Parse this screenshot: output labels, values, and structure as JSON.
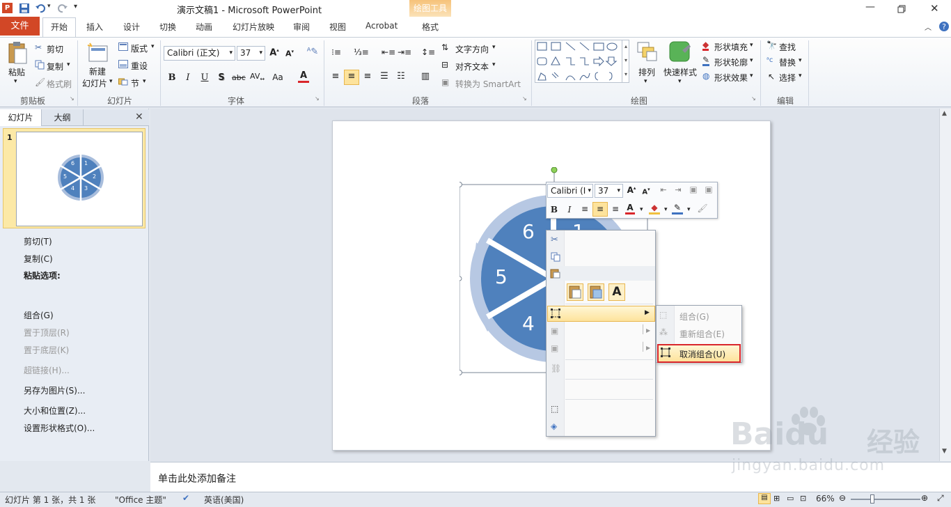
{
  "window": {
    "title": "演示文稿1 - Microsoft PowerPoint"
  },
  "context_tab_group": {
    "label": "绘图工具",
    "tab": "格式"
  },
  "tabs": [
    {
      "label": "文件"
    },
    {
      "label": "开始"
    },
    {
      "label": "插入"
    },
    {
      "label": "设计"
    },
    {
      "label": "切换"
    },
    {
      "label": "动画"
    },
    {
      "label": "幻灯片放映"
    },
    {
      "label": "审阅"
    },
    {
      "label": "视图"
    },
    {
      "label": "Acrobat"
    }
  ],
  "ribbon": {
    "clipboard": {
      "label": "剪贴板",
      "paste": "粘贴",
      "cut": "剪切",
      "copy": "复制",
      "format_painter": "格式刷"
    },
    "slides": {
      "label": "幻灯片",
      "new_slide_1": "新建",
      "new_slide_2": "幻灯片",
      "layout": "版式",
      "reset": "重设",
      "section": "节"
    },
    "font": {
      "label": "字体",
      "font_name": "Calibri (正文)",
      "font_size": "37"
    },
    "paragraph": {
      "label": "段落",
      "text_direction": "文字方向",
      "align_text": "对齐文本",
      "smartart": "转换为 SmartArt"
    },
    "drawing": {
      "label": "绘图",
      "arrange": "排列",
      "quick_styles": "快速样式",
      "shape_fill": "形状填充",
      "shape_outline": "形状轮廓",
      "shape_effects": "形状效果"
    },
    "editing": {
      "label": "编辑",
      "find": "查找",
      "replace": "替换",
      "select": "选择"
    }
  },
  "left_pane": {
    "tab_slides": "幻灯片",
    "tab_outline": "大纲",
    "slide_number": "1",
    "thumb_numbers": [
      "1",
      "2",
      "3",
      "4",
      "5",
      "6"
    ]
  },
  "slide": {
    "segments": [
      "6",
      "1",
      "5",
      "4"
    ]
  },
  "mini_toolbar": {
    "font_name": "Calibri (I",
    "font_size": "37"
  },
  "context_menu": {
    "cut": "剪切(T)",
    "copy": "复制(C)",
    "paste_options": "粘贴选项:",
    "group": "组合(G)",
    "bring_to_front": "置于顶层(R)",
    "send_to_back": "置于底层(K)",
    "hyperlink": "超链接(H)...",
    "save_as_picture": "另存为图片(S)...",
    "size_position": "大小和位置(Z)...",
    "format_shape": "设置形状格式(O)..."
  },
  "submenu": {
    "group": "组合(G)",
    "regroup": "重新组合(E)",
    "ungroup": "取消组合(U)"
  },
  "notes": {
    "placeholder": "单击此处添加备注"
  },
  "status": {
    "slide_info": "幻灯片 第 1 张，共 1 张",
    "theme": "\"Office 主题\"",
    "language": "英语(美国)",
    "zoom": "66%"
  },
  "watermark": {
    "brand": "Baidu",
    "brand_cn": "经验",
    "url": "jingyan.baidu.com"
  },
  "colors": {
    "accent_file": "#d24726",
    "shape_blue": "#4f81bd",
    "arrow_light": "#a8bddc",
    "highlight": "#fde39c",
    "red_box": "#d9262b"
  }
}
